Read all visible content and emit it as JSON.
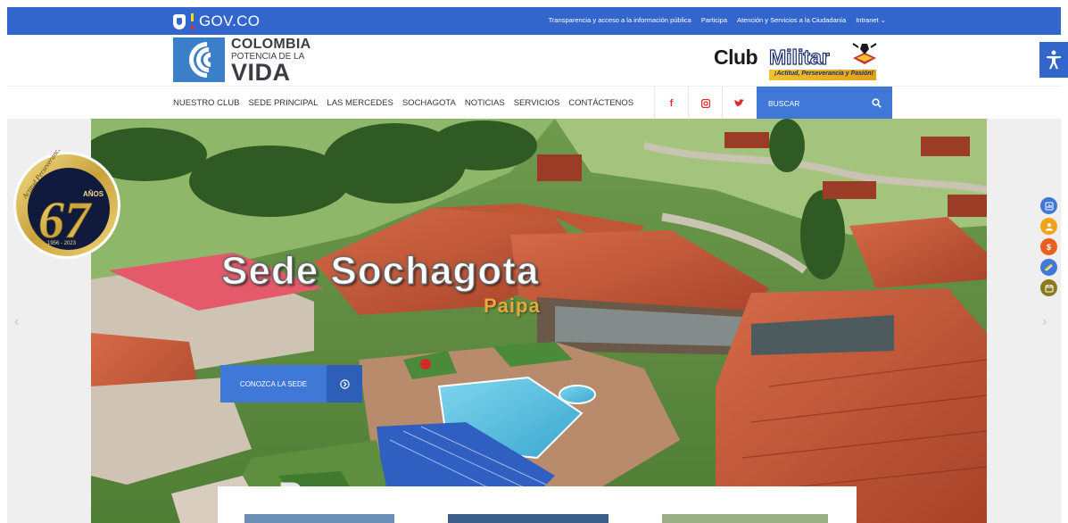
{
  "govbar": {
    "logo_text": "GOV.CO",
    "links": [
      "Transparencia y acceso a la información pública",
      "Participa",
      "Atención y Servicios a la Ciudadanía",
      "Intranet ⌄"
    ]
  },
  "colombia_logo": {
    "line1": "COLOMBIA",
    "line2": "POTENCIA DE LA",
    "line3": "VIDA"
  },
  "club_logo": {
    "club": "Club",
    "militar": "Militar",
    "motto": "¡Actitud, Perseverancia y Pasión!"
  },
  "nav": {
    "items": [
      "NUESTRO CLUB",
      "SEDE PRINCIPAL",
      "LAS MERCEDES",
      "SOCHAGOTA",
      "NOTICIAS",
      "SERVICIOS",
      "CONTÁCTENOS"
    ],
    "social": [
      "f",
      "◘",
      "🐦"
    ],
    "search_label": "BUSCAR"
  },
  "hero": {
    "title": "Sede Sochagota",
    "subtitle": "Paipa",
    "button_label": "CONOZCA LA SEDE"
  },
  "badge": {
    "years": "67",
    "years_label": "AÑOS",
    "arc_text": "Actitud Perseverancia Pasión",
    "dates": "1956 - 2023"
  },
  "colors": {
    "gov_blue": "#3366cc",
    "accent_blue": "#3f78d6",
    "red_social": "#e22b2b"
  },
  "side_icons": [
    "chart-icon",
    "user-icon",
    "dollar-icon",
    "link-icon",
    "calendar-icon"
  ]
}
